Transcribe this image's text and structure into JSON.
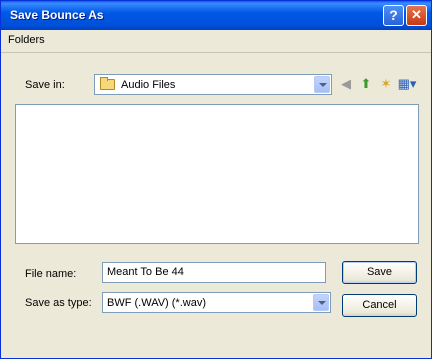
{
  "window": {
    "title": "Save Bounce As"
  },
  "titlebar": {
    "help_glyph": "?",
    "close_glyph": "✕"
  },
  "menu": {
    "folders": "Folders"
  },
  "save_in": {
    "label": "Save in:",
    "value": "Audio Files"
  },
  "toolbar": {
    "icons": [
      "back-icon",
      "up-folder-icon",
      "new-folder-icon",
      "views-menu-icon"
    ],
    "back_glyph": "◀",
    "up_glyph": "⬆",
    "new_glyph": "✶",
    "views_glyph": "▦▾"
  },
  "file_name": {
    "label": "File name:",
    "value": "Meant To Be 44"
  },
  "save_as_type": {
    "label": "Save as type:",
    "value": "BWF (.WAV) (*.wav)"
  },
  "buttons": {
    "save": "Save",
    "cancel": "Cancel"
  },
  "colors": {
    "titlebar": "#0058e6",
    "dialog_bg": "#ece9d8",
    "close": "#c43a14"
  }
}
